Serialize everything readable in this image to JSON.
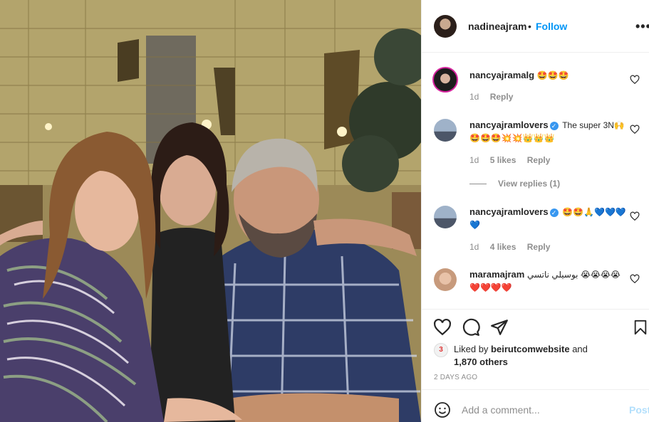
{
  "post": {
    "author": "nadineajram",
    "separator": "•",
    "follow_label": "Follow",
    "more_icon": "more-options-icon"
  },
  "comments": [
    {
      "username": "nancyajramalg",
      "verified": false,
      "text": "🤩🤩🤩",
      "age": "1d",
      "likes": "",
      "reply_label": "Reply"
    },
    {
      "username": "nancyajramlovers",
      "verified": true,
      "text": "The super 3N🙌🤩🤩🤩💥💥👑👑👑",
      "age": "1d",
      "likes": "5 likes",
      "reply_label": "Reply",
      "view_replies": "View replies (1)"
    },
    {
      "username": "nancyajramlovers",
      "verified": true,
      "text": "🤩🤩🙏💙💙💙💙",
      "age": "1d",
      "likes": "4 likes",
      "reply_label": "Reply"
    },
    {
      "username": "maramajram",
      "verified": false,
      "text": "بوسيلي ناتسي 😭😭😭😭❤️❤️❤️❤️",
      "age": "",
      "likes": "",
      "reply_label": ""
    }
  ],
  "engagement": {
    "liked_prefix": "Liked by",
    "liked_user": "beirutcomwebsite",
    "liked_and": "and",
    "liked_others": "1,870 others",
    "time_ago": "2 DAYS AGO"
  },
  "composer": {
    "placeholder": "Add a comment...",
    "post_label": "Post"
  },
  "colors": {
    "link_blue": "#0095f6",
    "muted": "#8e8e8e",
    "verified": "#3897f0",
    "post_disabled": "#b2dffc"
  }
}
